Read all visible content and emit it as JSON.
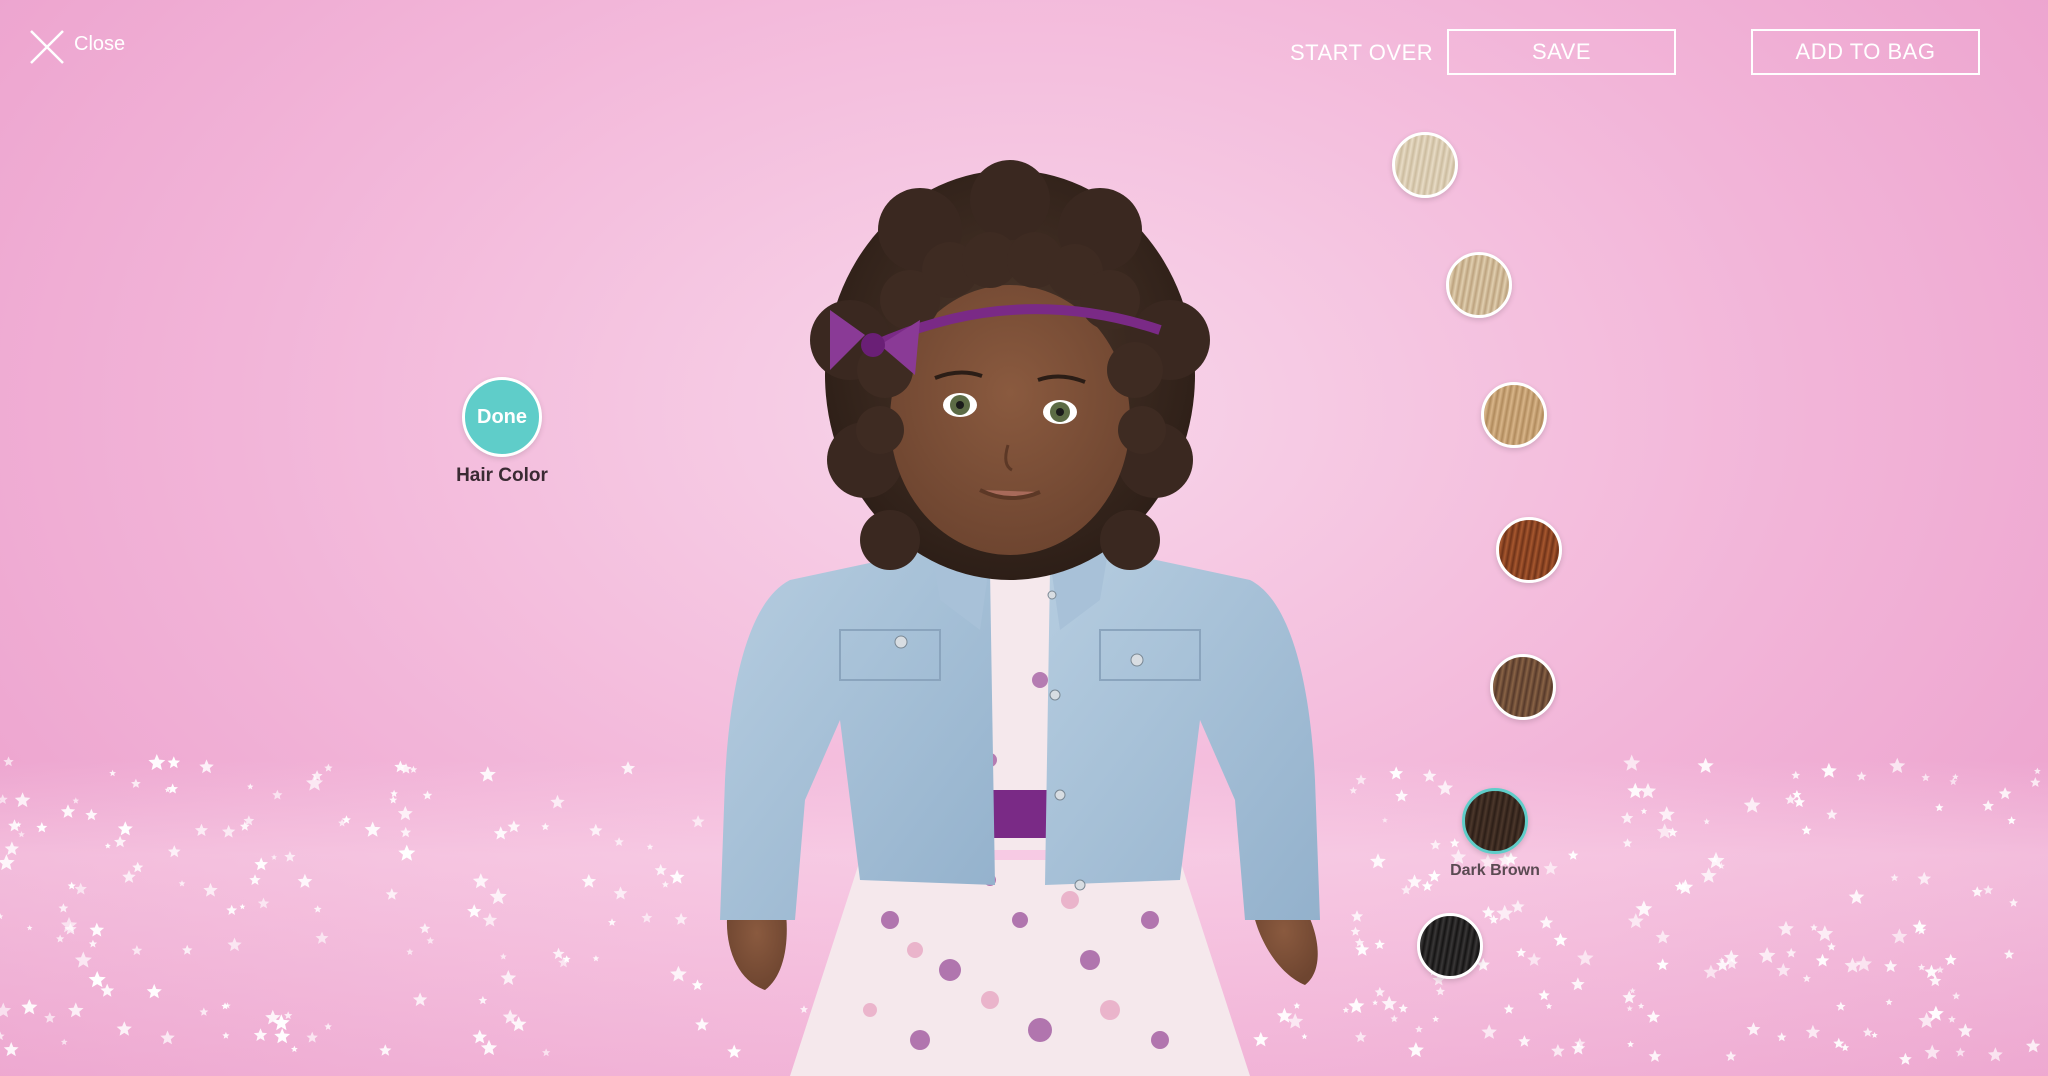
{
  "header": {
    "close_label": "Close",
    "start_over_label": "START OVER",
    "save_label": "SAVE",
    "add_to_bag_label": "ADD TO BAG"
  },
  "step": {
    "done_label": "Done",
    "title": "Hair Color"
  },
  "swatches": [
    {
      "name": "platinum-swatch",
      "colors": [
        "#e8dcc6",
        "#cbbb9e"
      ],
      "selected": false
    },
    {
      "name": "light-blonde-swatch",
      "colors": [
        "#e1cfb0",
        "#bca27e"
      ],
      "selected": false
    },
    {
      "name": "golden-blonde-swatch",
      "colors": [
        "#d9b68a",
        "#b08a5c"
      ],
      "selected": false
    },
    {
      "name": "auburn-swatch",
      "colors": [
        "#a8582f",
        "#6e3218"
      ],
      "selected": false
    },
    {
      "name": "brown-swatch",
      "colors": [
        "#8a6446",
        "#56392a"
      ],
      "selected": false
    },
    {
      "name": "dark-brown-swatch",
      "label": "Dark Brown",
      "colors": [
        "#4d382c",
        "#2b1d16"
      ],
      "selected": true
    },
    {
      "name": "black-swatch",
      "colors": [
        "#3a3838",
        "#141313"
      ],
      "selected": false
    }
  ],
  "colors": {
    "accent_teal": "#5fcdc9",
    "background_pink": "#f2b4d8"
  }
}
